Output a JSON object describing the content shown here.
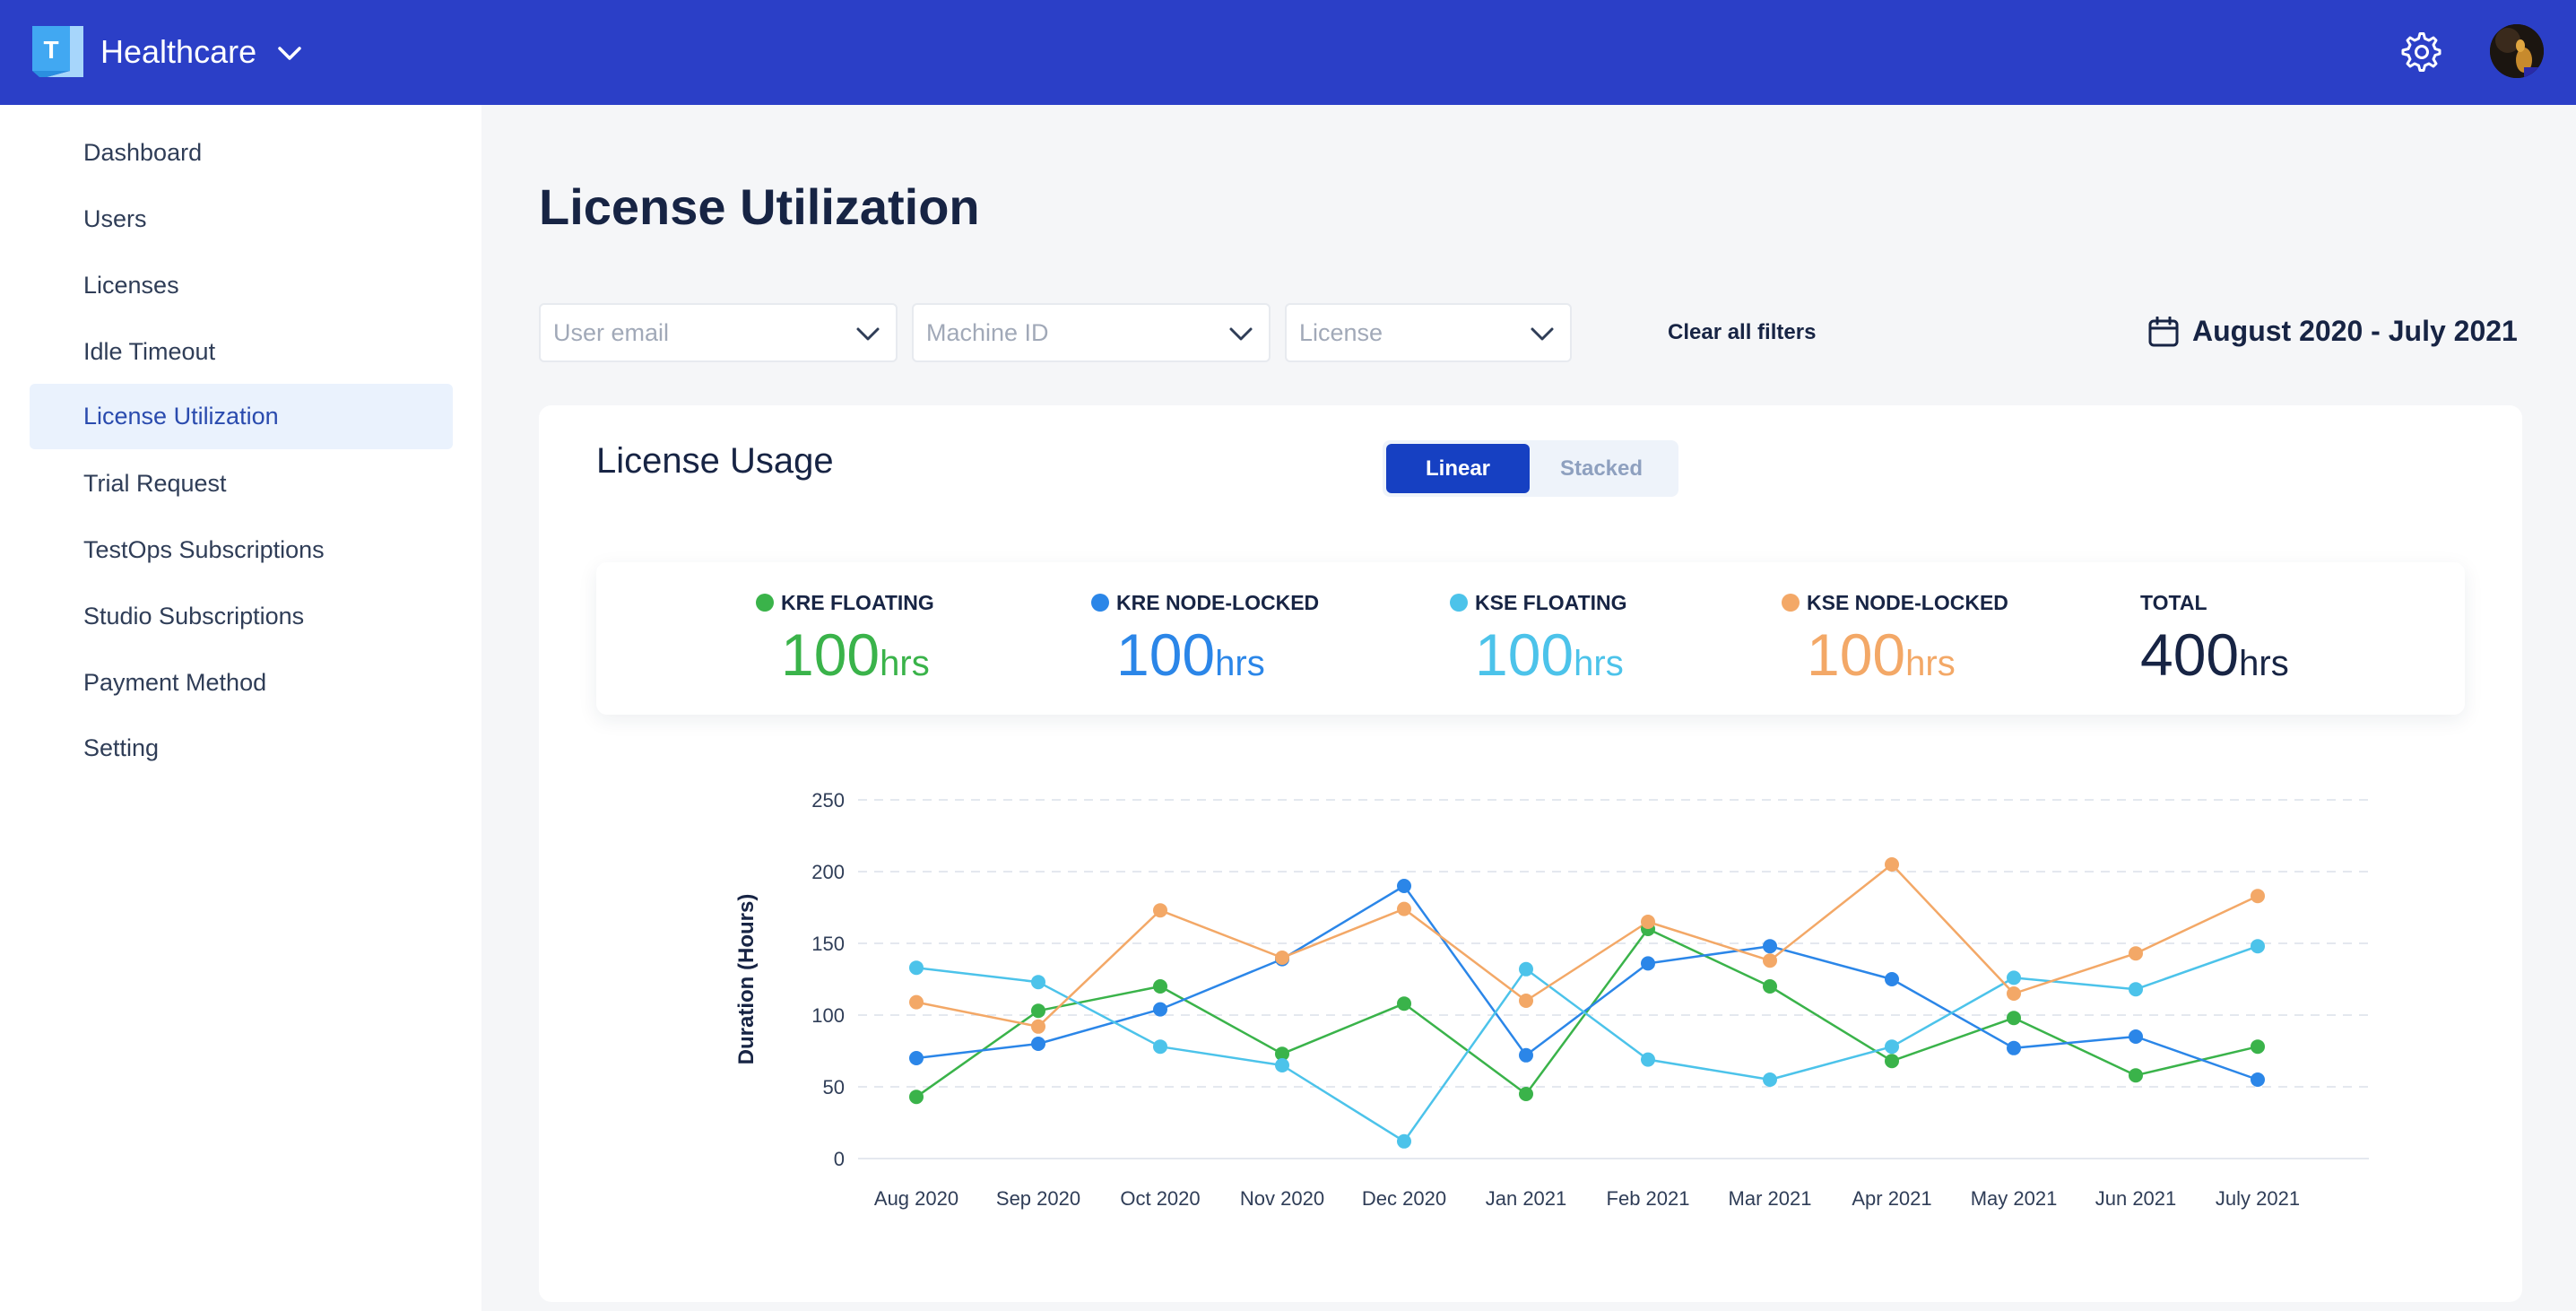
{
  "header": {
    "app_name": "Healthcare",
    "logo_letter": "T",
    "brand_color": "#2b3fc7"
  },
  "sidebar": {
    "items": [
      {
        "label": "Dashboard"
      },
      {
        "label": "Users"
      },
      {
        "label": "Licenses"
      },
      {
        "label": "Idle Timeout"
      },
      {
        "label": "License Utilization",
        "active": true
      },
      {
        "label": "Trial Request"
      },
      {
        "label": "TestOps Subscriptions"
      },
      {
        "label": "Studio Subscriptions"
      },
      {
        "label": "Payment Method"
      },
      {
        "label": "Setting"
      }
    ]
  },
  "page": {
    "title": "License Utilization"
  },
  "filters": {
    "user_email": "User email",
    "machine_id": "Machine ID",
    "license": "License",
    "clear_label": "Clear all filters",
    "date_range": "August 2020 - July 2021"
  },
  "card": {
    "title": "License Usage",
    "toggle": {
      "linear": "Linear",
      "stacked": "Stacked",
      "selected": "Linear"
    }
  },
  "summary": {
    "unit": "hrs",
    "items": [
      {
        "label": "KRE FLOATING",
        "value": "100",
        "color": "#3ab34a"
      },
      {
        "label": "KRE NODE-LOCKED",
        "value": "100",
        "color": "#2b86e8"
      },
      {
        "label": "KSE FLOATING",
        "value": "100",
        "color": "#4cc3ea"
      },
      {
        "label": "KSE NODE-LOCKED",
        "value": "100",
        "color": "#f3a867"
      },
      {
        "label": "TOTAL",
        "value": "400",
        "color": "#172444"
      }
    ]
  },
  "chart_data": {
    "type": "line",
    "ylabel": "Duration (Hours)",
    "xlabel": "",
    "ylim": [
      0,
      250
    ],
    "yticks": [
      0,
      50,
      100,
      150,
      200,
      250
    ],
    "grid": true,
    "categories": [
      "Aug 2020",
      "Sep 2020",
      "Oct 2020",
      "Nov 2020",
      "Dec 2020",
      "Jan 2021",
      "Feb 2021",
      "Mar 2021",
      "Apr 2021",
      "May 2021",
      "Jun 2021",
      "July 2021"
    ],
    "series": [
      {
        "name": "KRE FLOATING",
        "color": "#3ab34a",
        "values": [
          43,
          103,
          120,
          73,
          108,
          45,
          160,
          120,
          68,
          98,
          58,
          78
        ]
      },
      {
        "name": "KRE NODE-LOCKED",
        "color": "#2b86e8",
        "values": [
          70,
          80,
          104,
          139,
          190,
          72,
          136,
          148,
          125,
          77,
          85,
          55
        ]
      },
      {
        "name": "KSE FLOATING",
        "color": "#4cc3ea",
        "values": [
          133,
          123,
          78,
          65,
          12,
          132,
          69,
          55,
          78,
          126,
          118,
          148
        ]
      },
      {
        "name": "KSE NODE-LOCKED",
        "color": "#f3a867",
        "values": [
          109,
          92,
          173,
          140,
          174,
          110,
          165,
          138,
          205,
          115,
          143,
          183
        ]
      }
    ]
  }
}
